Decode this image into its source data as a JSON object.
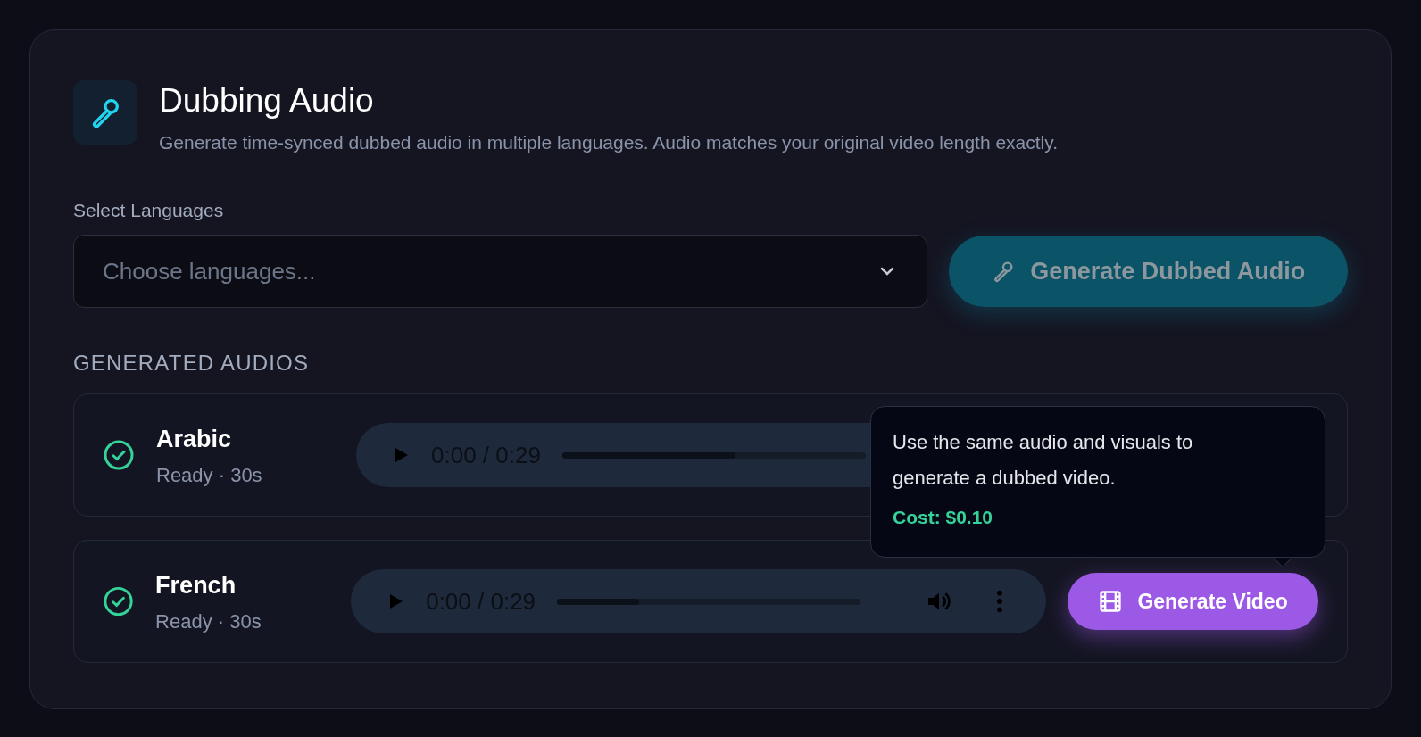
{
  "header": {
    "title": "Dubbing Audio",
    "subtitle": "Generate time-synced dubbed audio in multiple languages. Audio matches your original video length exactly."
  },
  "language_select": {
    "label": "Select Languages",
    "placeholder": "Choose languages..."
  },
  "generate_audio_button": {
    "label": "Generate Dubbed Audio",
    "disabled": true
  },
  "section_title": "GENERATED AUDIOS",
  "audios": [
    {
      "language": "Arabic",
      "status": "Ready · 30s",
      "ready": true,
      "time": "0:00 / 0:29",
      "level": 0.57,
      "controls_visible": false
    },
    {
      "language": "French",
      "status": "Ready · 30s",
      "ready": true,
      "time": "0:00 / 0:29",
      "level": 0.27,
      "controls_visible": true,
      "button": "Generate Video"
    }
  ],
  "tooltip": {
    "text": "Use the same audio and visuals to generate a dubbed video.",
    "cost": "Cost: $0.10"
  }
}
